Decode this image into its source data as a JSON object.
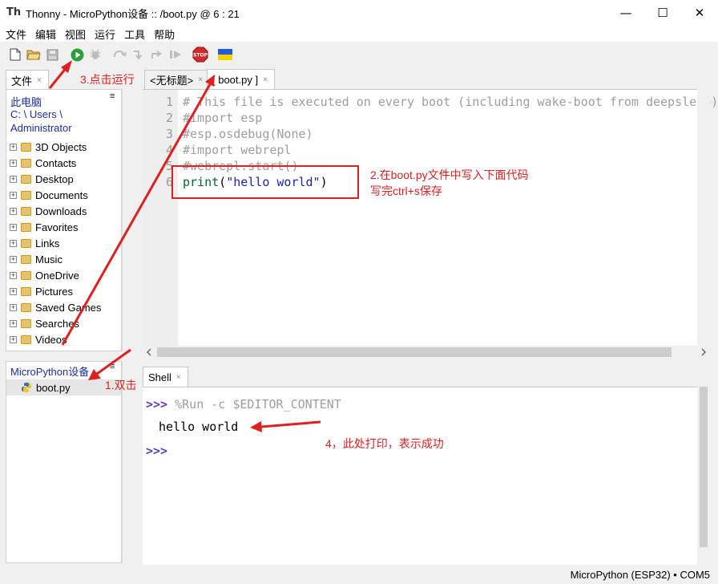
{
  "window": {
    "app_logo": "Th",
    "title": "Thonny  -  MicroPython设备 :: /boot.py  @  6 : 21",
    "minimize": "—",
    "maximize": "☐",
    "close": "✕"
  },
  "menu": [
    "文件",
    "编辑",
    "视图",
    "运行",
    "工具",
    "帮助"
  ],
  "toolbar": {
    "icons": [
      "new-file-icon",
      "open-folder-icon",
      "save-icon",
      "run-icon",
      "debug-icon",
      "step-over-icon",
      "step-into-icon",
      "step-out-icon",
      "resume-icon",
      "stop-icon",
      "ukraine-flag-icon"
    ],
    "stop_label": "STOP"
  },
  "files_panel": {
    "tab_label": "文件",
    "tab_close": "×",
    "menu_icon": "≡",
    "path_lines": [
      "此电脑",
      "C: \\ Users \\",
      "Administrator"
    ],
    "items": [
      "3D Objects",
      "Contacts",
      "Desktop",
      "Documents",
      "Downloads",
      "Favorites",
      "Links",
      "Music",
      "OneDrive",
      "Pictures",
      "Saved Games",
      "Searches",
      "Videos"
    ],
    "expand_glyph": "+"
  },
  "device_panel": {
    "title": "MicroPython设备",
    "menu_icon": "≡",
    "file": "boot.py"
  },
  "editor": {
    "tabs": [
      {
        "label": "<无标题>",
        "close": "×"
      },
      {
        "label": "[ boot.py ]",
        "close": "×"
      }
    ],
    "line_numbers": [
      "1",
      "2",
      "3",
      "4",
      "5",
      "6"
    ],
    "lines": [
      "# This file is executed on every boot (including wake-boot from deepsleep)",
      "#import esp",
      "#esp.osdebug(None)",
      "#import webrepl",
      "#webrepl.start()"
    ],
    "line6": {
      "func": "print",
      "open": "(",
      "str": "\"hello world\"",
      "close": ")"
    }
  },
  "shell": {
    "tab_label": "Shell",
    "tab_close": "×",
    "prompt": ">>>",
    "command": "%Run -c $EDITOR_CONTENT",
    "output": "hello world"
  },
  "status": {
    "text": "MicroPython (ESP32)  •  COM5"
  },
  "annotations": {
    "step1": "1.双击",
    "step2_line1": "2.在boot.py文件中写入下面代码",
    "step2_line2": "写完ctrl+s保存",
    "step3": "3.点击运行",
    "step4": "4，此处打印，表示成功"
  },
  "colors": {
    "annotation_red": "#e02020",
    "prompt_purple": "#5b3dc8",
    "keyword_green": "#006b2c",
    "string_blue": "#1b22b0",
    "link_blue": "#1a2f9c"
  }
}
